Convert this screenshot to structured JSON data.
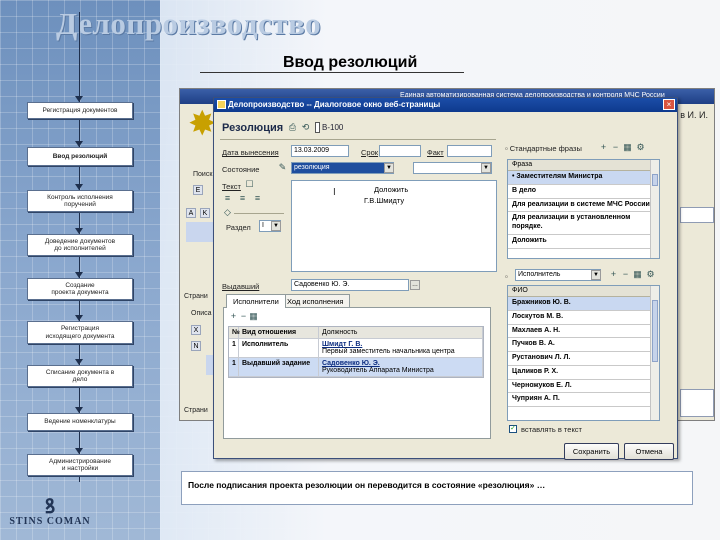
{
  "slide": {
    "title": "Делопроизводство",
    "subtitle": "Ввод резолюций",
    "caption": "После подписания проекта резолюции он переводится в состояние «резолюция» …",
    "logo_text": "STINS  COMAN"
  },
  "flow": [
    "Регистрация документов",
    "Ввод резолюций",
    "Контроль исполнения\nпоручений",
    "Доведение документов\nдо исполнителей",
    "Создание\nпроекта документа",
    "Регистрация\nисходящего документа",
    "Списание документа в\nдело",
    "Ведение номенклатуры",
    "Администрирование\nи настройки"
  ],
  "app": {
    "title": "Единая автоматизированная система делопроизводства и контроля МЧС России",
    "user": "в И. И.",
    "labels": {
      "search": "Поиск",
      "pages": "Страни",
      "pages2": "Страни",
      "desc": "Описа"
    }
  },
  "dialog": {
    "title": "Делопроизводство -- Диалоговое окно веб-страницы",
    "heading": "Резолюция",
    "number": "В-100",
    "labels": {
      "date": "Дата вынесения",
      "term": "Срок",
      "fact": "Факт",
      "state": "Состояние",
      "text": "Текст",
      "section": "Раздел",
      "issuer": "Выдавший"
    },
    "values": {
      "date": "13.03.2009",
      "state": "резолюция",
      "section": "I",
      "issuer": "Садовенко Ю. Э.",
      "text_line1": "Доложить",
      "text_line2": "Г.В.Шмидту"
    },
    "phrases": {
      "label": "Стандартные фразы",
      "header": "Фраза",
      "items": [
        "• Заместителям Министра",
        "В дело",
        "Для реализации в системе МЧС России.",
        "Для реализации в установленном порядке.",
        "Доложить"
      ]
    },
    "executors": {
      "selector": "Исполнитель",
      "header": "ФИО",
      "items": [
        "Бражников Ю. В.",
        "Лоскутов М. В.",
        "Махлаев А. Н.",
        "Пучков В. А.",
        "Рустанович Л. Л.",
        "Цаликов Р. Х.",
        "Черножуков Е. Л.",
        "Чуприян А. П."
      ],
      "insert_label": "вставлять в текст"
    },
    "tabs": [
      "Исполнители",
      "Ход исполнения"
    ],
    "grid": {
      "headers": [
        "№",
        "Вид отношения",
        "Должность"
      ],
      "rows": [
        {
          "num": "1",
          "relation": "Исполнитель",
          "name": "Шмидт Г. В.",
          "position": "Первый заместитель начальника центра"
        },
        {
          "num": "1",
          "relation": "Выдавший задание",
          "name": "Садовенко Ю. Э.",
          "position": "Руководитель Аппарата Министра"
        }
      ]
    },
    "buttons": {
      "save": "Сохранить",
      "cancel": "Отмена"
    }
  }
}
